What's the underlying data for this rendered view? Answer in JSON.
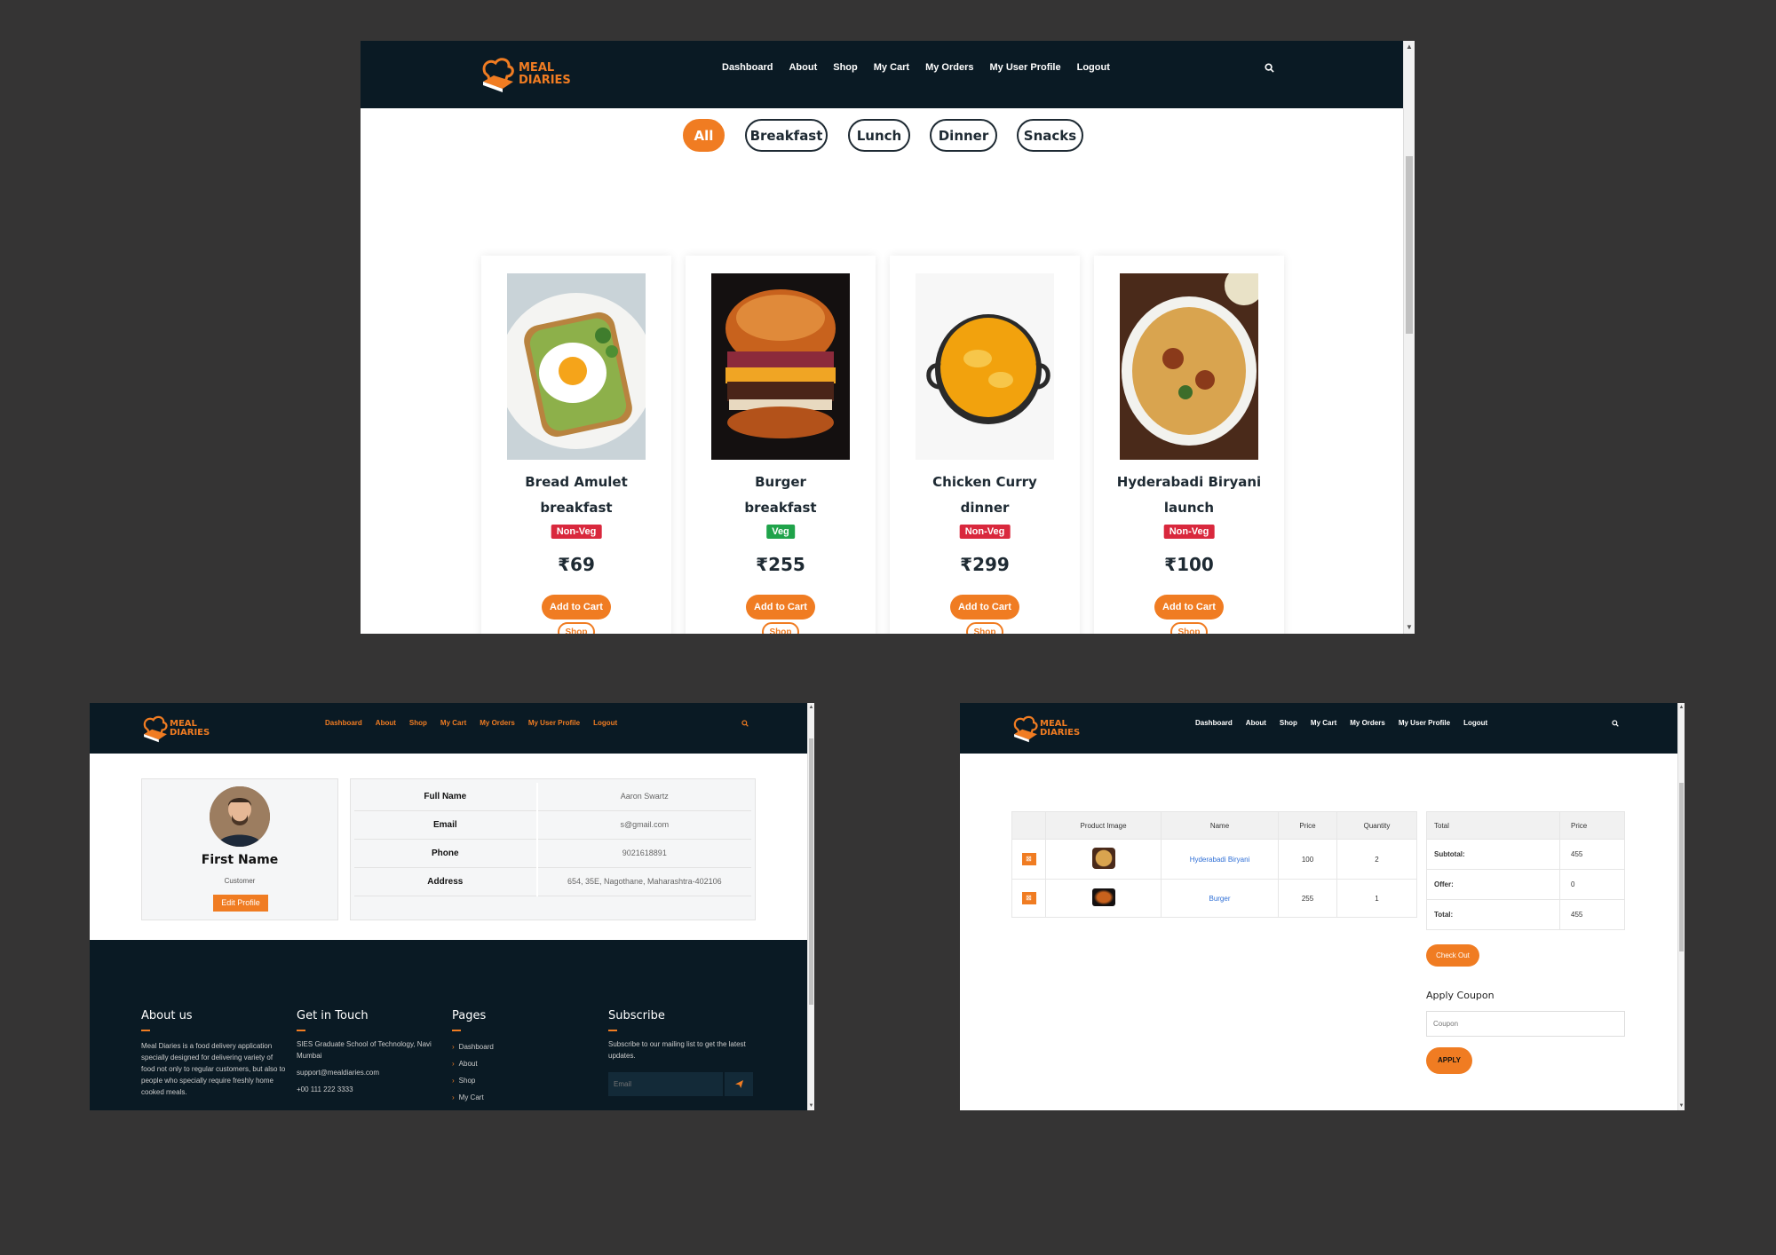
{
  "brand": {
    "line1": "MEAL",
    "line2": "DIARIES"
  },
  "nav": [
    "Dashboard",
    "About",
    "Shop",
    "My Cart",
    "My Orders",
    "My User Profile",
    "Logout"
  ],
  "colors": {
    "accent": "#f07c22",
    "navbar": "#0a1a24",
    "page_bg": "#353434",
    "nonveg": "#d9283d",
    "veg": "#1fa34a",
    "link": "#2f6fd6"
  },
  "shop": {
    "filters": [
      {
        "label": "All",
        "active": true
      },
      {
        "label": "Breakfast",
        "active": false
      },
      {
        "label": "Lunch",
        "active": false
      },
      {
        "label": "Dinner",
        "active": false
      },
      {
        "label": "Snacks",
        "active": false
      }
    ],
    "products": [
      {
        "name": "Bread Amulet",
        "category": "breakfast",
        "type": "Non-Veg",
        "price": "₹69",
        "image": "egg-toast"
      },
      {
        "name": "Burger",
        "category": "breakfast",
        "type": "Veg",
        "price": "₹255",
        "image": "burger"
      },
      {
        "name": "Chicken Curry",
        "category": "dinner",
        "type": "Non-Veg",
        "price": "₹299",
        "image": "curry"
      },
      {
        "name": "Hyderabadi Biryani",
        "category": "launch",
        "type": "Non-Veg",
        "price": "₹100",
        "image": "biryani"
      }
    ],
    "add_to_cart": "Add to Cart",
    "shop_label": "Shop"
  },
  "profile": {
    "name": "First Name",
    "role": "Customer",
    "edit": "Edit Profile",
    "fields": [
      {
        "label": "Full Name",
        "value": "Aaron Swartz"
      },
      {
        "label": "Email",
        "value": "s@gmail.com"
      },
      {
        "label": "Phone",
        "value": "9021618891"
      },
      {
        "label": "Address",
        "value": "654, 35E, Nagothane, Maharashtra-402106"
      }
    ]
  },
  "footer": {
    "about_title": "About us",
    "about_text": "Meal Diaries is a food delivery application specially designed for delivering variety of food not only to regular customers, but also to people who specially require freshly home cooked meals.",
    "touch_title": "Get in Touch",
    "address": "SIES Graduate School of Technology, Navi Mumbai",
    "email": "support@mealdiaries.com",
    "phone": "+00 111 222 3333",
    "pages_title": "Pages",
    "pages": [
      "Dashboard",
      "About",
      "Shop",
      "My Cart"
    ],
    "subscribe_title": "Subscribe",
    "subscribe_text": "Subscribe to our mailing list to get the latest updates.",
    "email_placeholder": "Email"
  },
  "cart": {
    "headers": [
      "",
      "Product Image",
      "Name",
      "Price",
      "Quantity"
    ],
    "rows": [
      {
        "name": "Hyderabadi Biryani",
        "price": "100",
        "qty": "2"
      },
      {
        "name": "Burger",
        "price": "255",
        "qty": "1"
      }
    ],
    "totals_headers": [
      "Total",
      "Price"
    ],
    "totals": [
      {
        "label": "Subtotal:",
        "value": "455"
      },
      {
        "label": "Offer:",
        "value": "0"
      },
      {
        "label": "Total:",
        "value": "455"
      }
    ],
    "checkout": "Check Out",
    "coupon_title": "Apply Coupon",
    "coupon_placeholder": "Coupon",
    "apply": "APPLY"
  }
}
